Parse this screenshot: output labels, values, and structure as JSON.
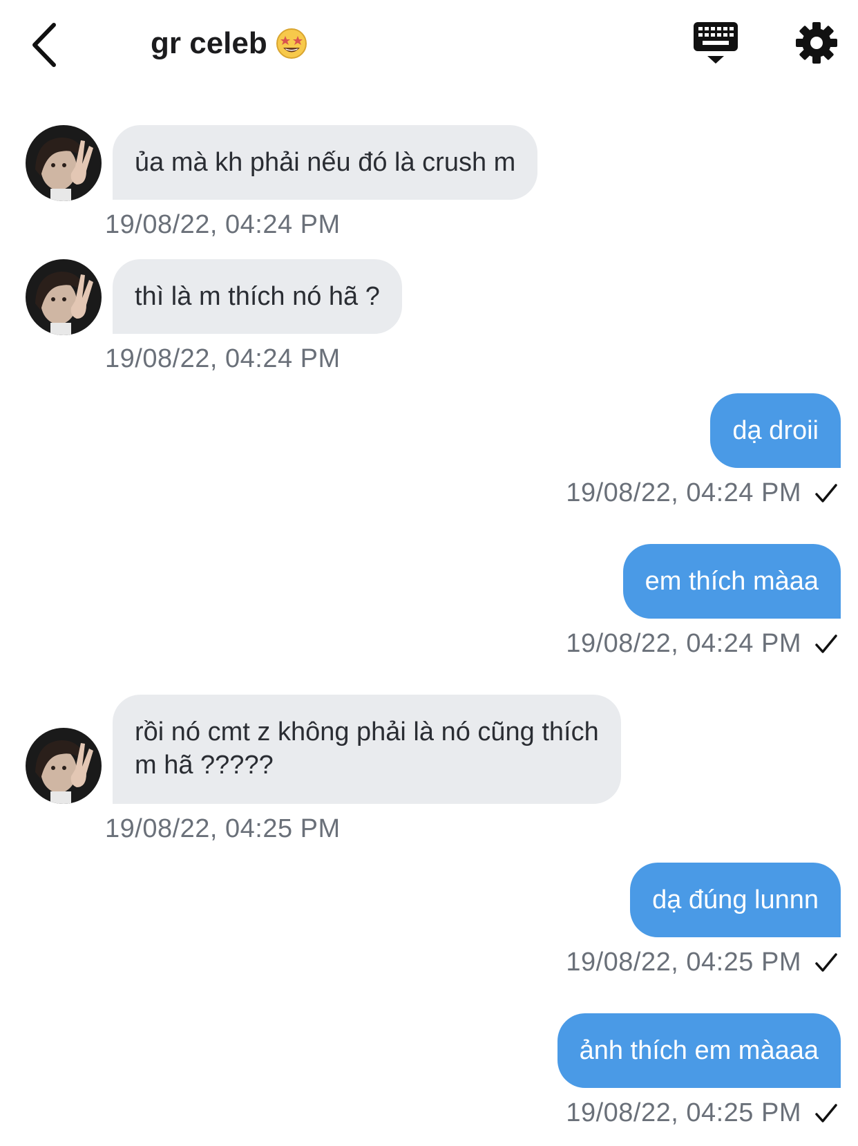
{
  "header": {
    "back_icon": "chevron-left-icon",
    "title": "gr celeb",
    "title_emoji": "star-struck-emoji",
    "keyboard_icon": "keyboard-icon",
    "settings_icon": "gear-icon"
  },
  "colors": {
    "incoming_bubble": "#e9ebee",
    "outgoing_bubble": "#4a9ae6",
    "timestamp": "#6a7079"
  },
  "messages": [
    {
      "direction": "in",
      "text": "ủa mà kh phải nếu đó là crush m",
      "time": "19/08/22, 04:24 PM"
    },
    {
      "direction": "in",
      "text": "thì là m thích nó hã ?",
      "time": "19/08/22, 04:24 PM"
    },
    {
      "direction": "out",
      "text": "dạ droii",
      "time": "19/08/22, 04:24 PM",
      "status": "sent"
    },
    {
      "direction": "out",
      "text": "em thích màaa",
      "time": "19/08/22, 04:24 PM",
      "status": "sent"
    },
    {
      "direction": "in",
      "text_line1": "rồi nó cmt z không phải là nó cũng thích",
      "text_line2": "m hã ?????",
      "time": "19/08/22, 04:25 PM"
    },
    {
      "direction": "out",
      "text": "dạ đúng lunnn",
      "time": "19/08/22, 04:25 PM",
      "status": "sent"
    },
    {
      "direction": "out",
      "text": "ảnh thích em màaaa",
      "time": "19/08/22, 04:25 PM",
      "status": "sent"
    }
  ]
}
